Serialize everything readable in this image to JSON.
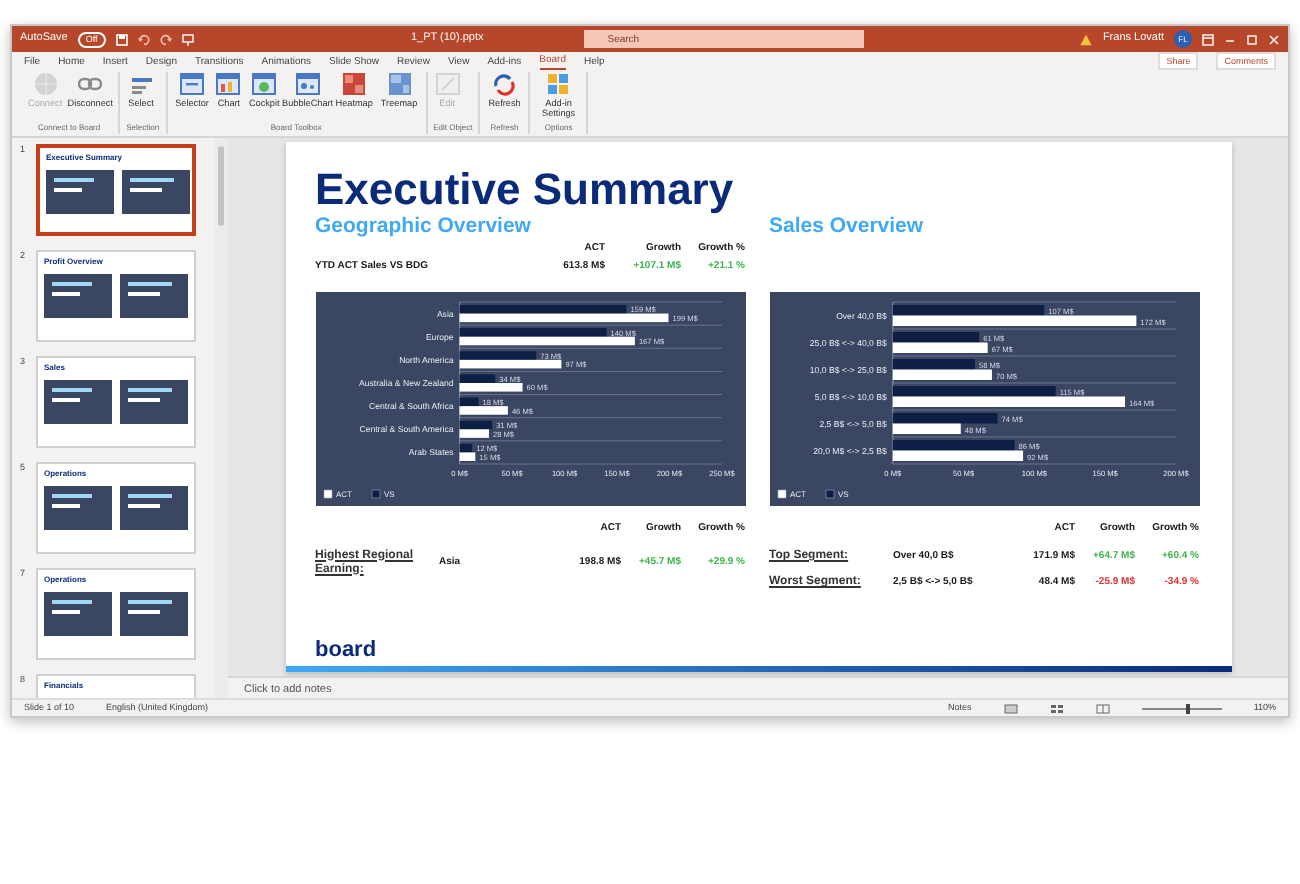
{
  "window": {
    "autosave_label": "AutoSave",
    "autosave_state": "Off",
    "title": "1_PT (10).pptx",
    "search": {
      "placeholder": "Search"
    },
    "user": "Frans Lovatt",
    "avatar": "FL"
  },
  "menu_tabs": [
    {
      "label": "File",
      "selected": false
    },
    {
      "label": "Home",
      "selected": false
    },
    {
      "label": "Insert",
      "selected": false
    },
    {
      "label": "Design",
      "selected": false
    },
    {
      "label": "Transitions",
      "selected": false
    },
    {
      "label": "Animations",
      "selected": false
    },
    {
      "label": "Slide Show",
      "selected": false
    },
    {
      "label": "Review",
      "selected": false
    },
    {
      "label": "View",
      "selected": false
    },
    {
      "label": "Add-ins",
      "selected": false
    },
    {
      "label": "Board",
      "selected": true
    },
    {
      "label": "Help",
      "selected": false
    }
  ],
  "share": "Share",
  "comments": "Comments",
  "ribbon_groups": [
    {
      "label": "Connect to Board",
      "buttons": [
        {
          "label": "Connect",
          "kind": "globe",
          "disabled": true
        },
        {
          "label": "Disconnect",
          "kind": "link",
          "disabled": false
        }
      ]
    },
    {
      "label": "Selection",
      "buttons": [
        {
          "label": "Select",
          "kind": "select",
          "disabled": false
        }
      ]
    },
    {
      "label": "Board Toolbox",
      "buttons": [
        {
          "label": "Selector",
          "kind": "selector",
          "disabled": false
        },
        {
          "label": "Chart",
          "kind": "chart",
          "disabled": false
        },
        {
          "label": "Cockpit",
          "kind": "cockpit",
          "disabled": false
        },
        {
          "label": "BubbleChart",
          "kind": "bubble",
          "disabled": false
        },
        {
          "label": "Heatmap",
          "kind": "heatmap",
          "disabled": false
        },
        {
          "label": "Treemap",
          "kind": "treemap",
          "disabled": false
        }
      ]
    },
    {
      "label": "Edit Object",
      "buttons": [
        {
          "label": "Edit",
          "kind": "edit",
          "disabled": true
        }
      ]
    },
    {
      "label": "Refresh",
      "buttons": [
        {
          "label": "Refresh",
          "kind": "refresh",
          "disabled": false
        }
      ]
    },
    {
      "label": "Options",
      "buttons": [
        {
          "label": "Add-in Settings",
          "kind": "settings",
          "disabled": false
        }
      ]
    }
  ],
  "slides": [
    {
      "number": "1",
      "title": "Executive Summary",
      "selected": true
    },
    {
      "number": "2",
      "title": "Profit Overview",
      "selected": false
    },
    {
      "number": "3",
      "title": "Sales",
      "selected": false
    },
    {
      "number": "5",
      "title": "Operations",
      "selected": false
    },
    {
      "number": "7",
      "title": "Operations",
      "selected": false
    },
    {
      "number": "8",
      "title": "Financials",
      "selected": false
    }
  ],
  "slide": {
    "title": "Executive Summary",
    "left": {
      "heading": "Geographic Overview",
      "metrics": {
        "columns": [
          "ACT",
          "Growth",
          "Growth %"
        ],
        "rows": [
          {
            "label": "YTD ACT Sales VS BDG",
            "values": [
              {
                "text": "613.8 M$",
                "color": "#1a1a1a"
              },
              {
                "text": "+107.1 M$",
                "color": "#3cb44b"
              },
              {
                "text": "+21.1 %",
                "color": "#3cb44b"
              }
            ]
          }
        ]
      },
      "chart_data": {
        "type": "bar",
        "orientation": "horizontal",
        "categories": [
          "Asia",
          "Europe",
          "North America",
          "Australia & New Zealand",
          "Central & South Africa",
          "Central & South America",
          "Arab States"
        ],
        "series": [
          {
            "name": "ACT",
            "color": "#ffffff",
            "values": [
              199,
              167,
              97,
              60,
              46,
              28,
              15
            ]
          },
          {
            "name": "VS",
            "color": "#0d1f45",
            "values": [
              159,
              140,
              73,
              34,
              18,
              31,
              12
            ]
          }
        ],
        "value_labels": [
          [
            "199 M$",
            "167 M$",
            "97 M$",
            "60 M$",
            "46 M$",
            "28 M$",
            "15 M$"
          ],
          [
            "159 M$",
            "140 M$",
            "73 M$",
            "34 M$",
            "18 M$",
            "31 M$",
            "12 M$"
          ]
        ],
        "legend": "bottom-left",
        "xlim": [
          0,
          250
        ],
        "xticks": [
          {
            "value": 0,
            "label": "0 M$"
          },
          {
            "value": 50,
            "label": "50 M$"
          },
          {
            "value": 100,
            "label": "100 M$"
          },
          {
            "value": 150,
            "label": "150 M$"
          },
          {
            "value": 200,
            "label": "200 M$"
          },
          {
            "value": 250,
            "label": "250 M$"
          }
        ]
      },
      "summary": {
        "label": "Highest Regional Earning:",
        "columns": [
          "ACT",
          "Growth",
          "Growth %"
        ],
        "rows": [
          {
            "segment": "Asia",
            "values": [
              {
                "text": "198.8 M$",
                "color": "#1a1a1a"
              },
              {
                "text": "+45.7 M$",
                "color": "#3cb44b"
              },
              {
                "text": "+29.9 %",
                "color": "#3cb44b"
              }
            ]
          }
        ]
      }
    },
    "right": {
      "heading": "Sales Overview",
      "chart_data": {
        "type": "bar",
        "orientation": "horizontal",
        "categories": [
          "Over 40,0 B$",
          "25,0 B$ <-> 40,0 B$",
          "10,0 B$ <-> 25,0 B$",
          "5,0 B$ <-> 10,0 B$",
          "2,5 B$ <-> 5,0 B$",
          "20,0 M$ <-> 2,5 B$"
        ],
        "series": [
          {
            "name": "ACT",
            "color": "#ffffff",
            "values": [
              172,
              67,
              70,
              164,
              48,
              92
            ]
          },
          {
            "name": "VS",
            "color": "#0d1f45",
            "values": [
              107,
              61,
              58,
              115,
              74,
              86
            ]
          }
        ],
        "value_labels": [
          [
            "172 M$",
            "67 M$",
            "70 M$",
            "164 M$",
            "48 M$",
            "92 M$"
          ],
          [
            "107 M$",
            "61 M$",
            "58 M$",
            "115 M$",
            "74 M$",
            "86 M$"
          ]
        ],
        "legend": "bottom-left",
        "xlim": [
          0,
          200
        ],
        "xticks": [
          {
            "value": 0,
            "label": "0 M$"
          },
          {
            "value": 50,
            "label": "50 M$"
          },
          {
            "value": 100,
            "label": "100 M$"
          },
          {
            "value": 150,
            "label": "150 M$"
          },
          {
            "value": 200,
            "label": "200 M$"
          }
        ]
      },
      "summary": {
        "columns": [
          "ACT",
          "Growth",
          "Growth %"
        ],
        "rows": [
          {
            "label": "Top Segment:",
            "segment": "Over 40,0 B$",
            "values": [
              {
                "text": "171.9 M$",
                "color": "#1a1a1a"
              },
              {
                "text": "+64.7 M$",
                "color": "#3cb44b"
              },
              {
                "text": "+60.4 %",
                "color": "#3cb44b"
              }
            ]
          },
          {
            "label": "Worst Segment:",
            "segment": "2,5 B$ <-> 5,0 B$",
            "values": [
              {
                "text": "48.4 M$",
                "color": "#1a1a1a"
              },
              {
                "text": "-25.9 M$",
                "color": "#e03030"
              },
              {
                "text": "-34.9 %",
                "color": "#e03030"
              }
            ]
          }
        ]
      }
    },
    "logo": "board"
  },
  "notes_placeholder": "Click to add notes",
  "status_bar": {
    "slide": "Slide 1 of 10",
    "language": "English (United Kingdom)",
    "notes": "Notes",
    "zoom_slider": {
      "level": 0.55
    },
    "zoom": "110%"
  }
}
